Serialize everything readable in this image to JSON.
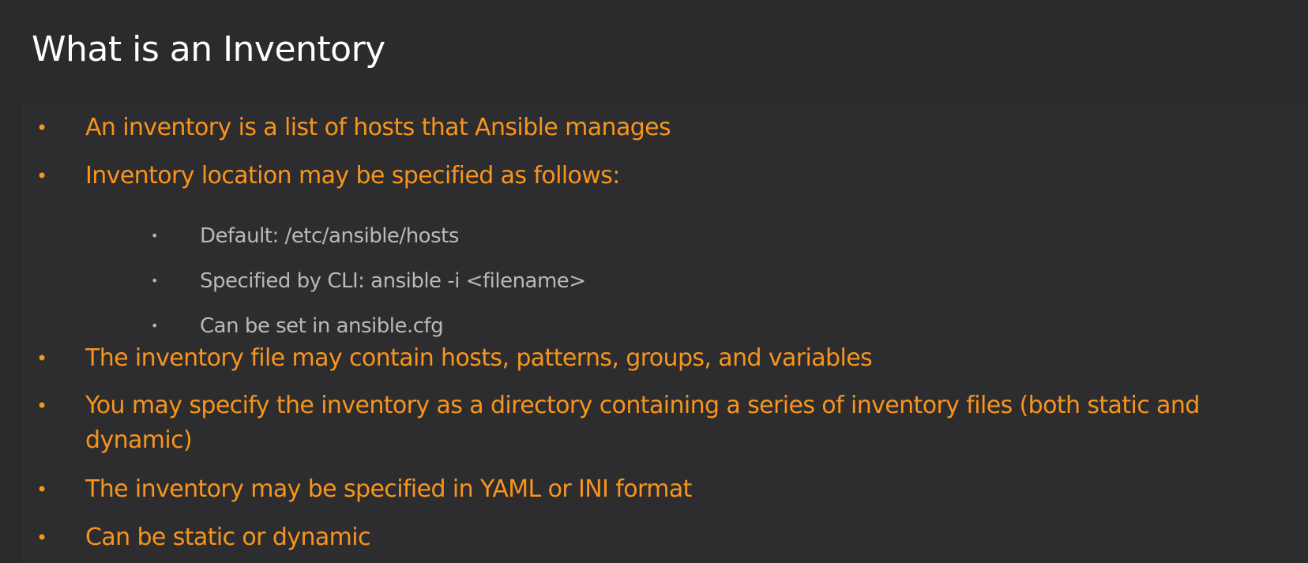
{
  "slide": {
    "title": "What is an Inventory",
    "bullets": [
      "An inventory is a list of hosts that Ansible manages",
      "Inventory location may be specified as follows:",
      "The inventory file may contain hosts, patterns, groups, and variables",
      "You may specify the inventory as a directory containing a series of inventory files (both static and dynamic)",
      "The inventory may be specified in YAML or INI format",
      "Can be static or dynamic"
    ],
    "sub_bullets": [
      "Default: /etc/ansible/hosts",
      "Specified by CLI: ansible -i <filename>",
      "Can be set in ansible.cfg"
    ],
    "bullet_glyph": "•"
  },
  "colors": {
    "background": "#2a292b",
    "title": "#ffffff",
    "bullet_text": "#f7951d",
    "sub_bullet_text": "#b9b9b9"
  }
}
